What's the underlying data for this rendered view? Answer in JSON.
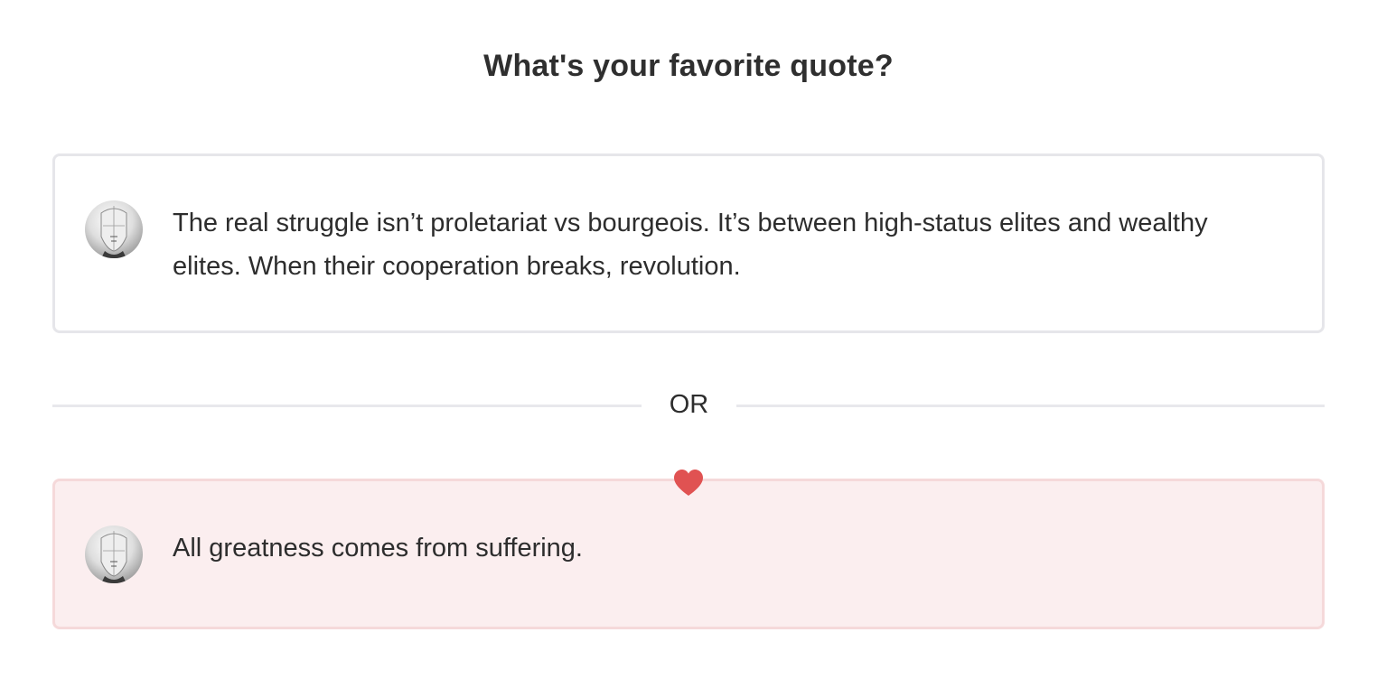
{
  "question": {
    "title": "What's your favorite quote?"
  },
  "options": [
    {
      "text": "The real struggle isn’t proletariat vs bourgeois. It’s between high-status elites and wealthy elites. When their cooperation breaks, revolution.",
      "selected": false
    },
    {
      "text": "All greatness comes from suffering.",
      "selected": true
    }
  ],
  "separator": {
    "label": "OR"
  },
  "icons": {
    "avatar": "sculpture-avatar-icon",
    "selected": "heart-icon"
  },
  "colors": {
    "heart": "#e05252",
    "selected_bg": "#fbeeef",
    "selected_border": "#f5d9da",
    "card_border": "#e6e6ea"
  }
}
